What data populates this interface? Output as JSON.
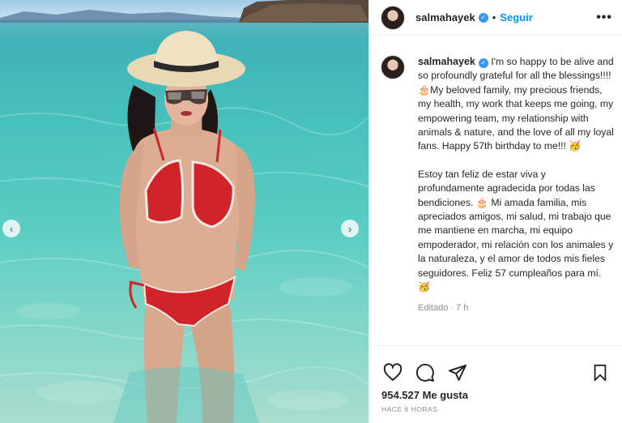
{
  "post": {
    "username": "salmahayek",
    "follow_label": "Seguir",
    "separator": "•",
    "more_label": "•••",
    "verified_mark": "✓",
    "caption_p1": "I'm so happy to be alive and so profoundly grateful for all the blessings!!!! 🎂My beloved family, my precious friends, my health, my work that keeps me going, my empowering team, my relationship with animals & nature, and the love of all my loyal fans. Happy 57th birthday to me!!! 🥳",
    "caption_p2": "Estoy tan feliz de estar viva y profundamente agradecida por todas las bendiciones. 🎂 Mi amada familia, mis apreciados amigos, mi salud, mi trabajo que me mantiene en marcha, mi equipo empoderador, mi relación con los animales y la naturaleza, y el amor de todos mis fieles seguidores. Feliz 57 cumpleaños para mí. 🥳",
    "edited_label": "Editado · 7 h",
    "likes": "954.527 Me gusta",
    "time_ago": "HACE 8 HORAS"
  },
  "media": {
    "prev_arrow": "‹",
    "next_arrow": "›"
  },
  "icons": {
    "like": "heart-icon",
    "comment": "comment-icon",
    "share": "share-icon",
    "save": "bookmark-icon"
  },
  "colors": {
    "accent": "#0095f6",
    "verified": "#3897f0",
    "water": "#48c2bd",
    "bikini": "#d1232a"
  }
}
